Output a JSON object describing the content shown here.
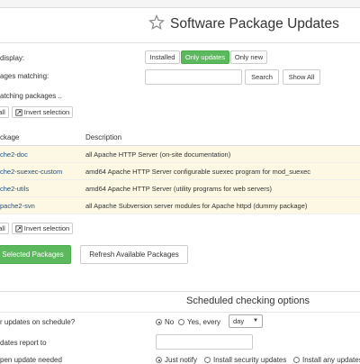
{
  "page": {
    "title": "Software Package Updates"
  },
  "filter": {
    "display_label": "display:",
    "display_options": [
      "Installed",
      "Only updates",
      "Only new"
    ],
    "active_display": "Only updates",
    "matching_label": "ages matching:",
    "search_value": "",
    "search_button": "Search",
    "show_all_button": "Show All"
  },
  "results": {
    "heading": "atching packages ..",
    "select_all": "all",
    "invert_selection": "Invert selection"
  },
  "table": {
    "headers": [
      "ckage",
      "Description"
    ],
    "rows": [
      {
        "package": "che2-doc",
        "description": "all Apache HTTP Server (on-site documentation)"
      },
      {
        "package": "che2-suexec-custom",
        "description": "amd64 Apache HTTP Server configurable suexec program for mod_suexec"
      },
      {
        "package": "che2-utils",
        "description": "amd64 Apache HTTP Server (utility programs for web servers)"
      },
      {
        "package": "pache2-svn",
        "description": "all Apache Subversion server modules for Apache httpd (dummy package)"
      }
    ]
  },
  "actions": {
    "select_all": "all",
    "invert_selection": "Invert selection",
    "update_button": "Selected Packages",
    "refresh_button": "Refresh Available Packages"
  },
  "schedule": {
    "title": "Scheduled checking options",
    "check_label": "r updates on schedule?",
    "no_label": "No",
    "yes_label": "Yes, every",
    "interval_value": "day",
    "report_label": "dates report to",
    "report_value": "",
    "when_label": "pen update needed",
    "just_notify": "Just notify",
    "install_security": "Install security updates",
    "install_any": "Install any updates"
  },
  "colors": {
    "accent_green": "#5cb85c",
    "row_highlight": "#fcf8e3",
    "link_blue": "#1b4f87"
  }
}
